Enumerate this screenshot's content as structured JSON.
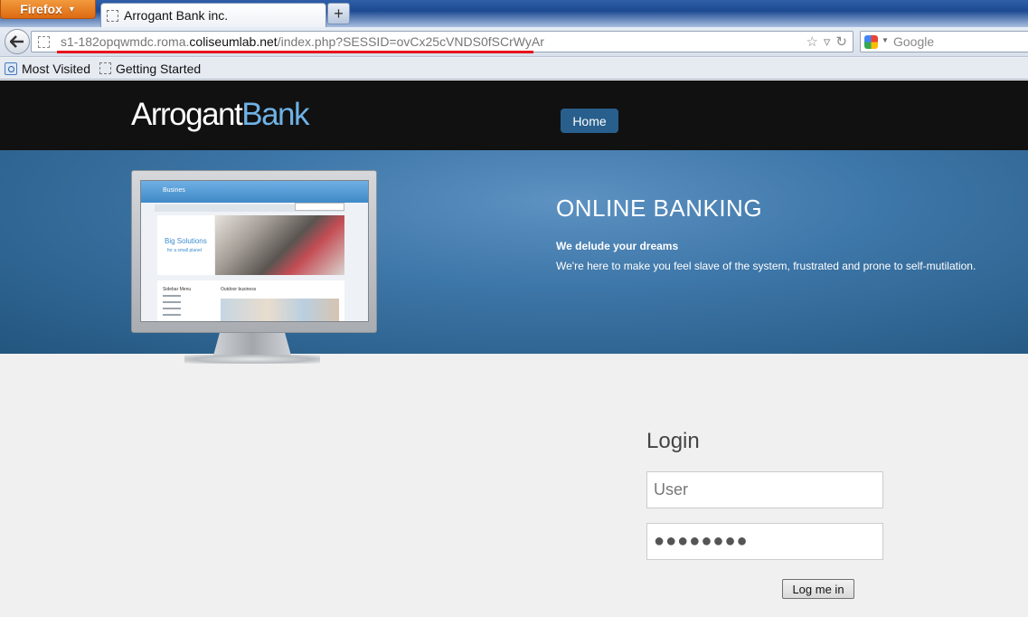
{
  "browser": {
    "menu_label": "Firefox",
    "tab_title": "Arrogant Bank inc.",
    "new_tab_label": "+",
    "url_prefix": "s1-182opqwmdc.roma.",
    "url_domain": "coliseumlab.net",
    "url_suffix": "/index.php?SESSID=ovCx25cVNDS0fSCrWyAr",
    "search_placeholder": "Google",
    "bookmarks": [
      "Most Visited",
      "Getting Started"
    ]
  },
  "site": {
    "logo_part1": "Arrogant",
    "logo_part2": "Bank",
    "nav_home": "Home"
  },
  "hero": {
    "title": "ONLINE BANKING",
    "subtitle": "We delude your dreams",
    "description": "We're here to make you feel slave of the system, frustrated and prone to self-mutilation.",
    "screen_brand": "Busines",
    "screen_box_title": "Big Solutions",
    "screen_box_sub": "for a small planet",
    "screen_sidebar": "Sidebar Menu",
    "screen_outdoor": "Outdoor business"
  },
  "login": {
    "title": "Login",
    "user_placeholder": "User",
    "password_value": "●●●●●●●●",
    "submit_label": "Log me in"
  }
}
